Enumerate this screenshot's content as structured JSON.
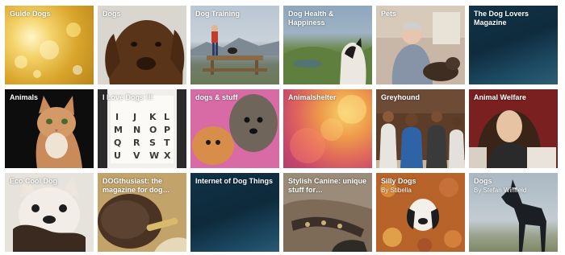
{
  "tiles": [
    {
      "title": "Guide Dogs",
      "icon": "golden-bokeh-image"
    },
    {
      "title": "Dogs",
      "icon": "chocolate-labrador-image"
    },
    {
      "title": "Dog Training",
      "icon": "child-dog-picnic-table-image"
    },
    {
      "title": "Dog Health & Happiness",
      "icon": "dog-on-hill-image"
    },
    {
      "title": "Pets",
      "icon": "woman-with-dog-image"
    },
    {
      "title": "The Dog Lovers Magazine",
      "icon": "dark-teal-gradient-image"
    },
    {
      "title": "Animals",
      "icon": "tabby-cat-image"
    },
    {
      "title": "I Love Dogs !!!",
      "icon": "dog-alphabet-chart-image"
    },
    {
      "title": "dogs & stuff",
      "icon": "fluffy-dogs-image"
    },
    {
      "title": "Animalshelter",
      "icon": "colorful-bokeh-image"
    },
    {
      "title": "Greyhound",
      "icon": "people-group-image"
    },
    {
      "title": "Animal Welfare",
      "icon": "woman-portrait-image"
    },
    {
      "title": "Eco Cool Dog",
      "icon": "french-bulldog-image"
    },
    {
      "title": "DOGthusiast: the magazine for dog…",
      "icon": "dog-chewing-image"
    },
    {
      "title": "Internet of Dog Things",
      "icon": "dark-teal-gradient-image"
    },
    {
      "title": "Stylish Canine: unique stuff for…",
      "icon": "dog-collar-image"
    },
    {
      "title": "Silly Dogs",
      "byline": "By Stibella",
      "icon": "dog-in-leaves-image"
    },
    {
      "title": "Dogs",
      "byline": "By Stefan Winfield",
      "icon": "great-dane-silhouette-image"
    }
  ]
}
